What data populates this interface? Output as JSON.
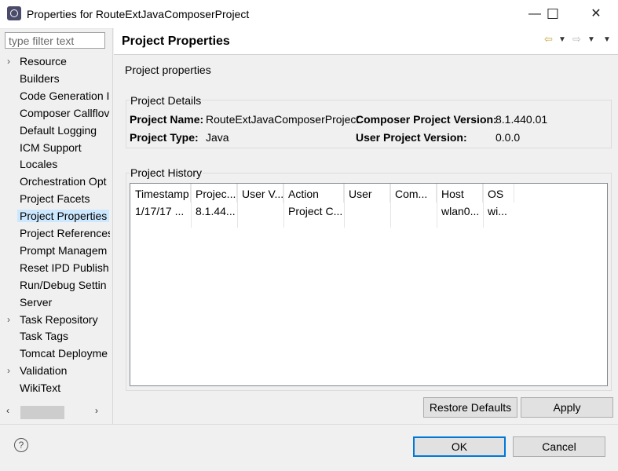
{
  "window": {
    "title": "Properties for RouteExtJavaComposerProject",
    "minimize_glyph": "—",
    "maximize_glyph": "☐",
    "close_glyph": "✕"
  },
  "filter": {
    "placeholder": "type filter text"
  },
  "tree": {
    "items": [
      {
        "label": "Resource",
        "expandable": true
      },
      {
        "label": "Builders",
        "expandable": false
      },
      {
        "label": "Code Generation I",
        "expandable": false
      },
      {
        "label": "Composer Callflov",
        "expandable": false
      },
      {
        "label": "Default Logging",
        "expandable": false
      },
      {
        "label": "ICM Support",
        "expandable": false
      },
      {
        "label": "Locales",
        "expandable": false
      },
      {
        "label": "Orchestration Opt",
        "expandable": false
      },
      {
        "label": "Project Facets",
        "expandable": false
      },
      {
        "label": "Project Properties",
        "expandable": false,
        "selected": true
      },
      {
        "label": "Project References",
        "expandable": false
      },
      {
        "label": "Prompt Managem",
        "expandable": false
      },
      {
        "label": "Reset IPD Publish",
        "expandable": false
      },
      {
        "label": "Run/Debug Settin",
        "expandable": false
      },
      {
        "label": "Server",
        "expandable": false
      },
      {
        "label": "Task Repository",
        "expandable": true
      },
      {
        "label": "Task Tags",
        "expandable": false
      },
      {
        "label": "Tomcat Deployme",
        "expandable": false
      },
      {
        "label": "Validation",
        "expandable": true
      },
      {
        "label": "WikiText",
        "expandable": false
      }
    ],
    "chevron_glyph": "›"
  },
  "page": {
    "title": "Project Properties",
    "description": "Project properties"
  },
  "details": {
    "title": "Project Details",
    "project_name_label": "Project Name:",
    "project_name_value": "RouteExtJavaComposerProject",
    "composer_version_label": "Composer Project Version:",
    "composer_version_value": "8.1.440.01",
    "project_type_label": "Project Type:",
    "project_type_value": "Java",
    "user_version_label": "User Project Version:",
    "user_version_value": "0.0.0"
  },
  "history": {
    "title": "Project History",
    "columns": [
      "Timestamp",
      "Projec...",
      "User V...",
      "Action",
      "User",
      "Com...",
      "Host",
      "OS"
    ],
    "rows": [
      [
        "1/17/17 ...",
        "8.1.44...",
        "",
        "Project C...",
        "",
        "",
        "wlan0...",
        "wi..."
      ]
    ]
  },
  "buttons": {
    "restore_defaults": "Restore Defaults",
    "apply": "Apply",
    "ok": "OK",
    "cancel": "Cancel"
  },
  "help_glyph": "?",
  "colors": {
    "selection": "#cce8ff",
    "accent": "#0078d7",
    "nav_icon": "#c7a63c"
  }
}
